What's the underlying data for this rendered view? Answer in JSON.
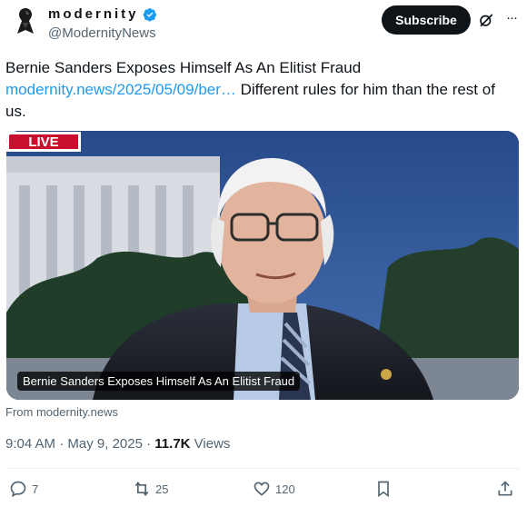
{
  "author": {
    "display_name": "modernity",
    "handle": "@ModernityNews",
    "verified": true,
    "avatar_icon": "eagle-silhouette-icon"
  },
  "header": {
    "subscribe_label": "Subscribe",
    "grok_icon": "grok-icon",
    "more_icon": "more-icon"
  },
  "post": {
    "title": "Bernie Sanders Exposes Himself As An Elitist Fraud",
    "link_text": "modernity.news/2025/05/09/ber…",
    "body_text": " Different rules for him than the rest of us."
  },
  "card": {
    "live_badge": "LIVE",
    "caption": "Bernie Sanders Exposes Himself As An Elitist Fraud",
    "source": "From modernity.news"
  },
  "meta": {
    "time": "9:04 AM",
    "date": "May 9, 2025",
    "views_count": "11.7K",
    "views_label": "Views",
    "separator": " · "
  },
  "actions": {
    "replies": "7",
    "reposts": "25",
    "likes": "120"
  },
  "colors": {
    "link": "#1d9bf0",
    "muted": "#536471",
    "text": "#0f1419",
    "verified": "#1d9bf0"
  }
}
